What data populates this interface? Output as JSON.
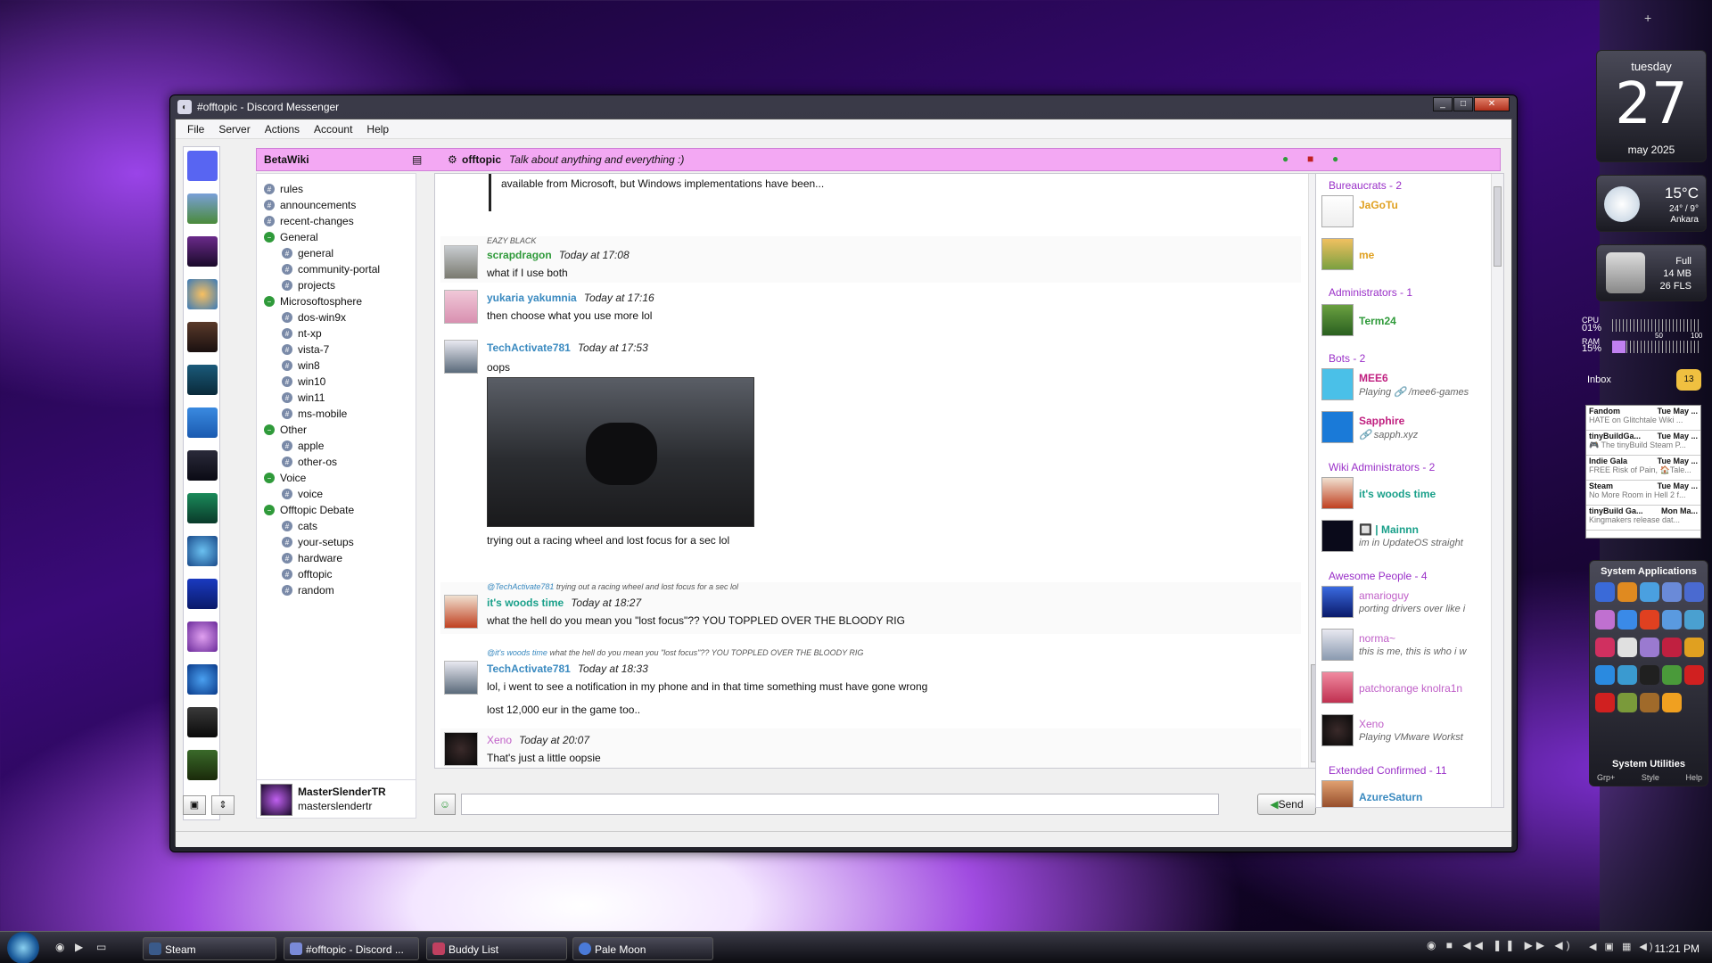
{
  "window": {
    "title": "#offtopic - Discord Messenger"
  },
  "menu": [
    "File",
    "Server",
    "Actions",
    "Account",
    "Help"
  ],
  "server": {
    "name": "BetaWiki"
  },
  "channel": {
    "name": "offtopic",
    "topic": "Talk about anything and everything :)"
  },
  "channels": [
    {
      "label": "rules",
      "kind": "channel"
    },
    {
      "label": "announcements",
      "kind": "channel"
    },
    {
      "label": "recent-changes",
      "kind": "channel"
    },
    {
      "label": "General",
      "kind": "category"
    },
    {
      "label": "general",
      "kind": "sub"
    },
    {
      "label": "community-portal",
      "kind": "sub"
    },
    {
      "label": "projects",
      "kind": "sub"
    },
    {
      "label": "Microsoftosphere",
      "kind": "category"
    },
    {
      "label": "dos-win9x",
      "kind": "sub"
    },
    {
      "label": "nt-xp",
      "kind": "sub"
    },
    {
      "label": "vista-7",
      "kind": "sub"
    },
    {
      "label": "win8",
      "kind": "sub"
    },
    {
      "label": "win10",
      "kind": "sub"
    },
    {
      "label": "win11",
      "kind": "sub"
    },
    {
      "label": "ms-mobile",
      "kind": "sub"
    },
    {
      "label": "Other",
      "kind": "category"
    },
    {
      "label": "apple",
      "kind": "sub"
    },
    {
      "label": "other-os",
      "kind": "sub"
    },
    {
      "label": "Voice",
      "kind": "category"
    },
    {
      "label": "voice",
      "kind": "sub"
    },
    {
      "label": "Offtopic Debate",
      "kind": "category"
    },
    {
      "label": "cats",
      "kind": "sub"
    },
    {
      "label": "your-setups",
      "kind": "sub"
    },
    {
      "label": "hardware",
      "kind": "sub"
    },
    {
      "label": "offtopic",
      "kind": "sub"
    },
    {
      "label": "random",
      "kind": "sub"
    }
  ],
  "user": {
    "display": "MasterSlenderTR",
    "handle": "masterslendertr"
  },
  "messages": {
    "m0_text": "available from Microsoft, but Windows implementations have been...",
    "m1": {
      "tag": "EAZY BLACK",
      "author": "scrapdragon",
      "time": "Today at 17:08",
      "text": "what if I use both",
      "color": "#2f9a3a"
    },
    "m2": {
      "author": "yukaria yakumnia",
      "time": "Today at 17:16",
      "text": "then choose what you use more lol",
      "color": "#3a8ac0"
    },
    "m3": {
      "author": "TechActivate781",
      "time": "Today at 17:53",
      "text": "oops",
      "caption": "trying out a racing wheel and lost focus for a sec lol",
      "color": "#3a8ac0"
    },
    "m4": {
      "reply_name": "@TechActivate781",
      "reply_text": "trying out a racing wheel and lost focus for a sec lol",
      "author": "it's woods time",
      "time": "Today at 18:27",
      "text": "what the hell do you mean you \"lost focus\"?? YOU TOPPLED OVER THE BLOODY RIG",
      "color": "#1aa08a"
    },
    "m5": {
      "reply_name": "@it's woods time",
      "reply_text": "what the hell do you mean you \"lost focus\"?? YOU TOPPLED OVER THE BLOODY RIG",
      "author": "TechActivate781",
      "time": "Today at 18:33",
      "text": "lol, i went to see a notification in my phone and in that time something must have gone wrong",
      "text2": "lost 12,000 eur in the game too..",
      "color": "#3a8ac0"
    },
    "m6": {
      "author": "Xeno",
      "time": "Today at 20:07",
      "text": "That's just a little oopsie",
      "color": "#c060c8"
    }
  },
  "send_label": "Send",
  "members": {
    "g1": "Bureaucrats - 2",
    "u1": {
      "name": "JaGoTu",
      "color": "#e0a020"
    },
    "u2": {
      "name": "me",
      "color": "#e0a020"
    },
    "g2": "Administrators - 1",
    "u3": {
      "name": "Term24",
      "color": "#2f9a3a"
    },
    "g3": "Bots - 2",
    "u4": {
      "name": "MEE6",
      "status": "Playing 🔗 /mee6-games",
      "color": "#c02080"
    },
    "u5": {
      "name": "Sapphire",
      "status": "🔗 sapph.xyz",
      "color": "#c02080"
    },
    "g4": "Wiki Administrators - 2",
    "u6": {
      "name": "it's woods time",
      "color": "#1aa08a"
    },
    "u7": {
      "name": "🔲 | Mainnn",
      "status": "im in UpdateOS straight",
      "color": "#1aa08a"
    },
    "g5": "Awesome People - 4",
    "u8": {
      "name": "amarioguy",
      "status": "porting drivers over like i",
      "color": "#c060c8"
    },
    "u9": {
      "name": "norma~",
      "status": "this is me, this is who i w",
      "color": "#c060c8"
    },
    "u10": {
      "name": "patchorange knolra1n",
      "color": "#c060c8"
    },
    "u11": {
      "name": "Xeno",
      "status": "Playing VMware Workst",
      "color": "#c060c8"
    },
    "g6": "Extended Confirmed - 11",
    "u12": {
      "name": "AzureSaturn",
      "color": "#3a8ac0"
    }
  },
  "gadgets": {
    "day": "tuesday",
    "date": "27",
    "month": "may 2025",
    "temp": "15°C",
    "temp_range": "24° / 9°",
    "city": "Ankara",
    "bin_status": "Full",
    "bin_size": "14 MB",
    "bin_files": "26 FLS",
    "cpu_label": "CPU",
    "cpu": "01%",
    "ram_label": "RAM",
    "ram": "15%",
    "scale_mid": "50",
    "scale_max": "100",
    "inbox": "Inbox",
    "inbox_count": "13",
    "mail": [
      {
        "from": "Fandom",
        "date": "Tue May ...",
        "subject": "HATE on Glitchtale Wiki ..."
      },
      {
        "from": "tinyBuildGa...",
        "date": "Tue May ...",
        "subject": "🎮 The tinyBuild Steam P..."
      },
      {
        "from": "Indie Gala",
        "date": "Tue May ...",
        "subject": "FREE Risk of Pain, 🏠Tale..."
      },
      {
        "from": "Steam",
        "date": "Tue May ...",
        "subject": "No More Room in Hell 2 f..."
      },
      {
        "from": "tinyBuild Ga...",
        "date": "Mon Ma...",
        "subject": "Kingmakers release dat..."
      }
    ],
    "sysapps": "System Applications",
    "sysutils": "System Utilities",
    "tabs": [
      "Grp+",
      "Style",
      "Help"
    ]
  },
  "taskbar": {
    "tasks": [
      "Steam",
      "#offtopic - Discord ...",
      "Buddy List",
      "Pale Moon"
    ],
    "clock": "11:21 PM"
  }
}
